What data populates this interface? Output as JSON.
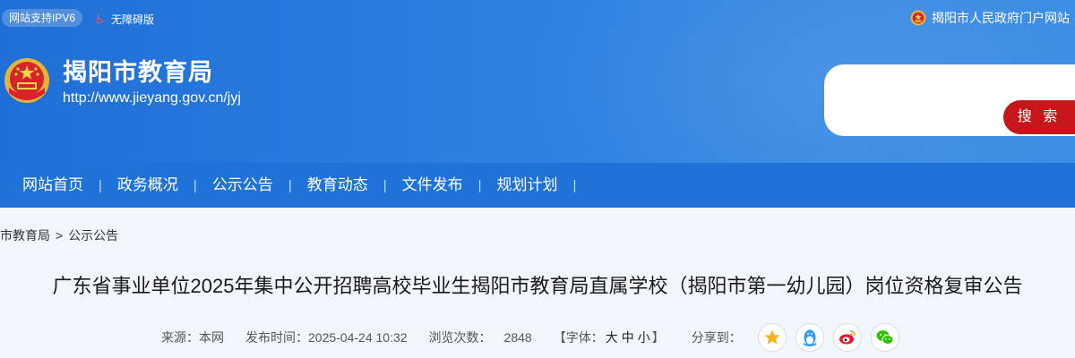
{
  "topbar": {
    "ipv6_badge": "网站支持IPV6",
    "accessible_label": "无障碍版",
    "portal_link": "揭阳市人民政府门户网站"
  },
  "site": {
    "title": "揭阳市教育局",
    "url": "http://www.jieyang.gov.cn/jyj"
  },
  "search": {
    "placeholder": "",
    "button_label": "搜 索"
  },
  "nav": {
    "items": [
      {
        "label": "网站首页"
      },
      {
        "label": "政务概况"
      },
      {
        "label": "公示公告"
      },
      {
        "label": "教育动态"
      },
      {
        "label": "文件发布"
      },
      {
        "label": "规划计划"
      }
    ],
    "separator": "|"
  },
  "breadcrumb": {
    "items": [
      "市教育局",
      "公示公告"
    ],
    "separator": ">"
  },
  "article": {
    "title": "广东省事业单位2025年集中公开招聘高校毕业生揭阳市教育局直属学校（揭阳市第一幼儿园）岗位资格复审公告",
    "meta": {
      "source": "来源：本网",
      "publish_time": "发布时间：2025-04-24 10:32",
      "views_label": "浏览次数：",
      "views_value": "2848",
      "font_size_prefix": "【字体：",
      "font_large": "大",
      "font_medium": "中",
      "font_small": "小",
      "font_size_suffix": "】",
      "share_label": "分享到："
    }
  },
  "colors": {
    "header_blue": "#2d7fe0",
    "nav_blue": "#1f73d8",
    "search_red": "#c8141b",
    "page_bg": "#f1f6fc"
  },
  "icons": {
    "accessible": "wheelchair-icon",
    "portal": "national-emblem-icon",
    "share_qzone": "qzone-star-icon",
    "share_qq": "qq-penguin-icon",
    "share_weibo": "weibo-icon",
    "share_wechat": "wechat-icon"
  }
}
